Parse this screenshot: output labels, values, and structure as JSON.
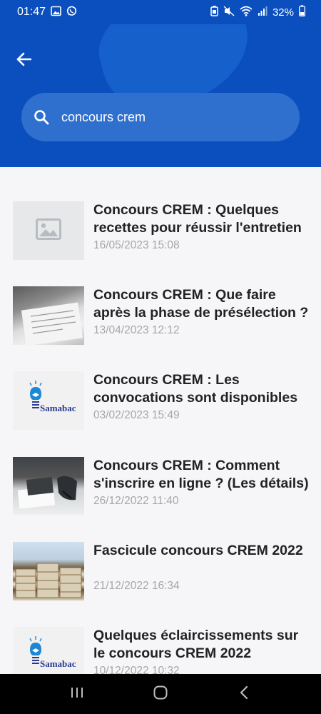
{
  "status_bar": {
    "time": "01:47",
    "battery": "32%",
    "icons": [
      "image-notification-icon",
      "whatsapp-icon",
      "battery-saver-icon",
      "mute-icon",
      "wifi-icon",
      "signal-icon",
      "battery-icon"
    ]
  },
  "header": {
    "back_icon": "back-arrow-icon",
    "search": {
      "value": "concours crem",
      "icon": "search-icon"
    }
  },
  "articles": [
    {
      "title": "Concours CREM : Quelques recettes pour réussir l'entretien",
      "date": "16/05/2023 15:08",
      "thumb": "image-placeholder"
    },
    {
      "title": "Concours CREM : Que faire après la phase de présélection ?",
      "date": "13/04/2023 12:12",
      "thumb": "paper-photo"
    },
    {
      "title": "Concours CREM : Les convocations sont disponibles",
      "date": "03/02/2023 15:49",
      "thumb": "samabac-logo",
      "logo_text": "Samabac"
    },
    {
      "title": "Concours CREM : Comment s'inscrire en ligne ? (Les détails)",
      "date": "26/12/2022 11:40",
      "thumb": "desk-photo"
    },
    {
      "title": "Fascicule concours CREM 2022",
      "date": "21/12/2022 16:34",
      "thumb": "books-photo"
    },
    {
      "title": "Quelques éclaircissements sur le concours CREM 2022",
      "date": "10/12/2022 10:32",
      "thumb": "samabac-logo",
      "logo_text": "Samabac"
    }
  ],
  "nav_bar": {
    "buttons": [
      "recent-apps-icon",
      "home-icon",
      "back-icon"
    ]
  },
  "colors": {
    "primary": "#0b4fbf",
    "search_bg": "#2f70cf",
    "title": "#222222",
    "date": "#a7a7ab",
    "background": "#f6f6f8"
  }
}
